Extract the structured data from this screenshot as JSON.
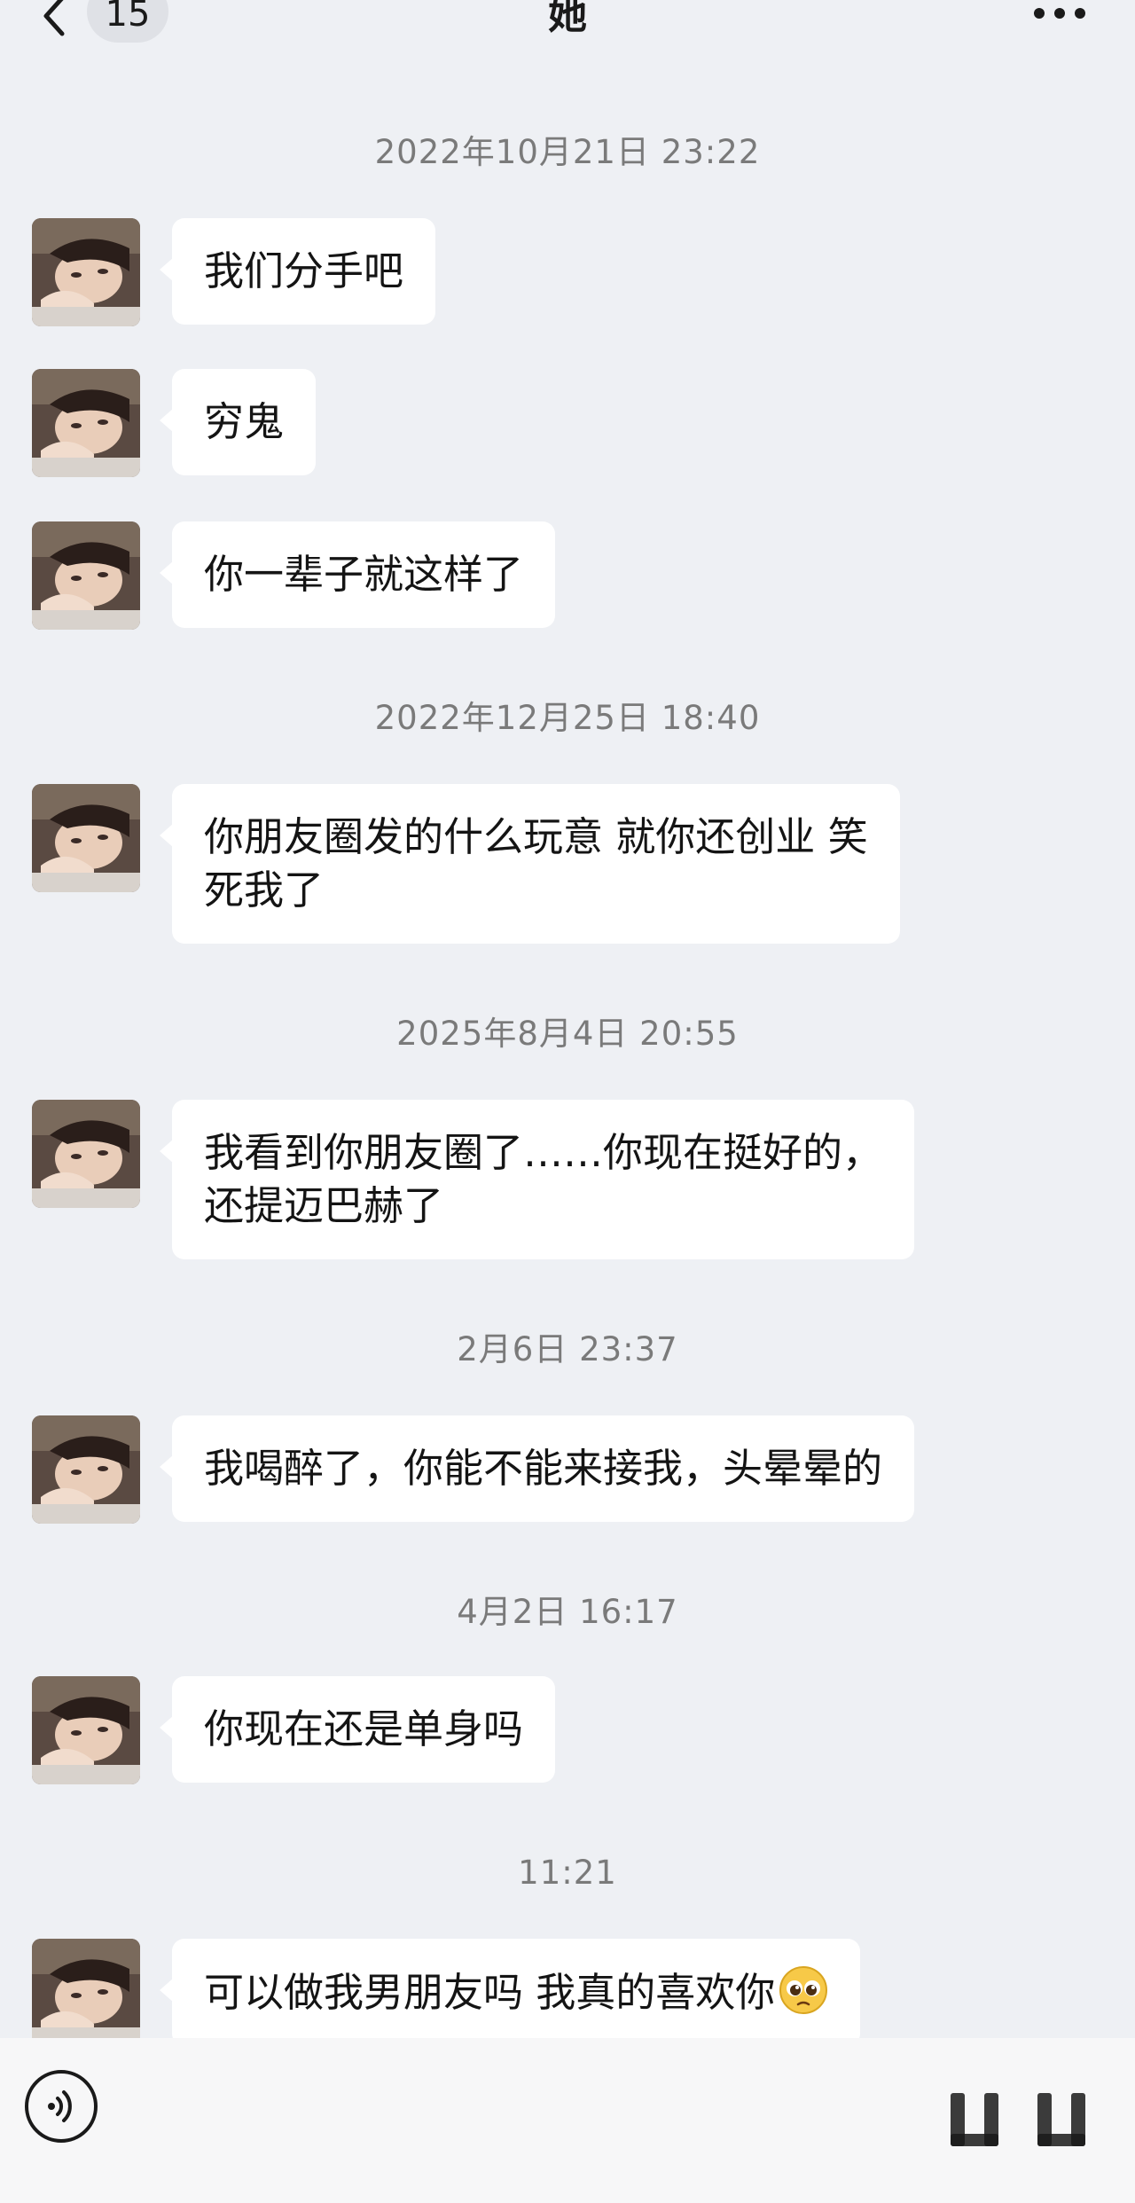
{
  "header": {
    "back_icon": "chevron-left-icon",
    "unread_count": "15",
    "contact_name": "她",
    "more_icon": "more-dots-icon"
  },
  "messages": [
    {
      "type": "time",
      "text": "2022年10月21日 23:22"
    },
    {
      "type": "msg",
      "text": "我们分手吧"
    },
    {
      "type": "msg",
      "text": "穷鬼"
    },
    {
      "type": "msg",
      "text": "你一辈子就这样了"
    },
    {
      "type": "time",
      "text": "2022年12月25日 18:40"
    },
    {
      "type": "msg",
      "lines": [
        "你朋友圈发的什么玩意 就你还创业 笑",
        "死我了"
      ]
    },
    {
      "type": "time",
      "text": "2025年8月4日 20:55"
    },
    {
      "type": "msg",
      "lines": [
        "我看到你朋友圈了……你现在挺好的，",
        "还提迈巴赫了"
      ]
    },
    {
      "type": "time",
      "text": "2月6日 23:37"
    },
    {
      "type": "msg",
      "text": "我喝醉了，你能不能来接我，头晕晕的"
    },
    {
      "type": "time",
      "text": "4月2日 16:17"
    },
    {
      "type": "msg",
      "text": "你现在还是单身吗"
    },
    {
      "type": "time",
      "text": "11:21"
    },
    {
      "type": "msg",
      "text": "可以做我男朋友吗 我真的喜欢你",
      "emoji": "pleading-face-emoji"
    }
  ],
  "input_bar": {
    "voice_icon": "voice-input-icon",
    "input_value": ""
  },
  "colors": {
    "background": "#eef0f4",
    "bubble": "#ffffff",
    "timestamp_text": "#7a7a7a"
  }
}
